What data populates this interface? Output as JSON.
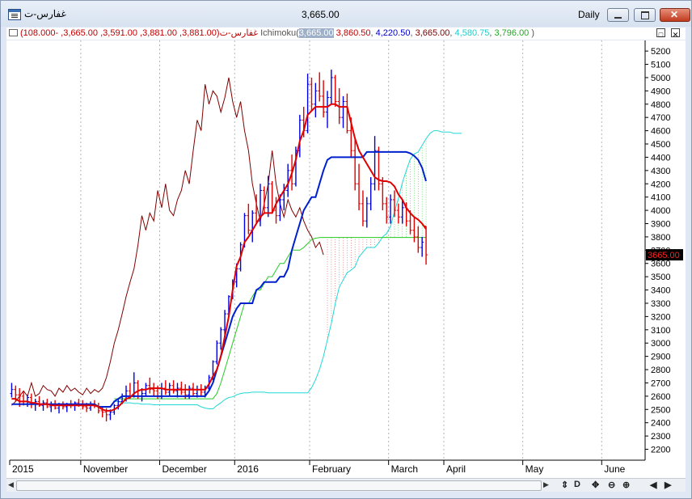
{
  "window": {
    "title": "غفارس-ت",
    "last_price": "3,665.00",
    "period": "Daily"
  },
  "legend": {
    "symbol": "غفارس-ت",
    "ohlc": "(3,881.00, 3,881.00, 3,591.00, 3,665.00, -108.000)",
    "indicator": "Ichimoku",
    "values": [
      {
        "text": "3,665.00",
        "color": "#ffffff",
        "bg": "#9db0c8"
      },
      {
        "text": "3,860.50",
        "color": "#c00000"
      },
      {
        "text": "4,220.50",
        "color": "#0000c8"
      },
      {
        "text": "3,665.00",
        "color": "#7a0000"
      },
      {
        "text": "4,580.75",
        "color": "#22cccc"
      },
      {
        "text": "3,796.00",
        "color": "#22aa22"
      }
    ],
    "open_paren": "(",
    "close_paren": ")"
  },
  "toolbar": {
    "buttons": [
      {
        "name": "sync-button",
        "label": "⇕"
      },
      {
        "name": "data-button",
        "label": "D"
      },
      {
        "name": "move-button",
        "label": "✥"
      },
      {
        "name": "zoom-out-button",
        "label": "⊖"
      },
      {
        "name": "zoom-in-button",
        "label": "⊕"
      },
      {
        "name": "scroll-left-button",
        "label": "◀"
      },
      {
        "name": "scroll-right-button",
        "label": "▶"
      }
    ]
  },
  "chart_data": {
    "type": "line",
    "title": "",
    "y_ticks": [
      2200,
      2300,
      2400,
      2500,
      2600,
      2700,
      2800,
      2900,
      3000,
      3100,
      3200,
      3300,
      3400,
      3500,
      3600,
      3700,
      3800,
      3900,
      4000,
      4100,
      4200,
      4300,
      4400,
      4500,
      4600,
      4700,
      4800,
      4900,
      5000,
      5100,
      5200
    ],
    "ylim": [
      2130,
      5280
    ],
    "last_price_label": "3665.00",
    "last_price": 3665,
    "x_labels": [
      {
        "text": "2015",
        "bar": 0
      },
      {
        "text": "November",
        "bar": 18
      },
      {
        "text": "December",
        "bar": 38
      },
      {
        "text": "2016",
        "bar": 57
      },
      {
        "text": "February",
        "bar": 76
      },
      {
        "text": "March",
        "bar": 96
      },
      {
        "text": "April",
        "bar": 110
      },
      {
        "text": "May",
        "bar": 130
      },
      {
        "text": "June",
        "bar": 150
      }
    ],
    "bar_count": 161,
    "grid_vertical_bars": [
      18,
      38,
      57,
      76,
      96,
      110,
      130,
      150
    ],
    "price_bars": [
      [
        2620,
        2700,
        2590,
        2650
      ],
      [
        2650,
        2680,
        2560,
        2610
      ],
      [
        2610,
        2660,
        2520,
        2600
      ],
      [
        2600,
        2640,
        2530,
        2560
      ],
      [
        2560,
        2610,
        2520,
        2590
      ],
      [
        2590,
        2620,
        2510,
        2540
      ],
      [
        2540,
        2580,
        2490,
        2560
      ],
      [
        2560,
        2600,
        2520,
        2530
      ],
      [
        2530,
        2570,
        2490,
        2550
      ],
      [
        2550,
        2580,
        2510,
        2520
      ],
      [
        2520,
        2560,
        2480,
        2540
      ],
      [
        2540,
        2570,
        2500,
        2510
      ],
      [
        2510,
        2550,
        2470,
        2530
      ],
      [
        2530,
        2560,
        2500,
        2520
      ],
      [
        2520,
        2550,
        2480,
        2540
      ],
      [
        2540,
        2570,
        2510,
        2530
      ],
      [
        2530,
        2560,
        2490,
        2550
      ],
      [
        2550,
        2580,
        2520,
        2540
      ],
      [
        2540,
        2570,
        2500,
        2520
      ],
      [
        2520,
        2550,
        2480,
        2510
      ],
      [
        2510,
        2560,
        2490,
        2540
      ],
      [
        2540,
        2570,
        2510,
        2530
      ],
      [
        2530,
        2550,
        2470,
        2490
      ],
      [
        2490,
        2520,
        2440,
        2480
      ],
      [
        2480,
        2510,
        2410,
        2460
      ],
      [
        2460,
        2500,
        2420,
        2480
      ],
      [
        2480,
        2540,
        2460,
        2530
      ],
      [
        2530,
        2580,
        2500,
        2560
      ],
      [
        2560,
        2620,
        2540,
        2600
      ],
      [
        2600,
        2680,
        2560,
        2640
      ],
      [
        2640,
        2700,
        2580,
        2600
      ],
      [
        2600,
        2780,
        2590,
        2700
      ],
      [
        2700,
        2720,
        2580,
        2600
      ],
      [
        2600,
        2660,
        2560,
        2620
      ],
      [
        2620,
        2700,
        2600,
        2680
      ],
      [
        2680,
        2740,
        2620,
        2650
      ],
      [
        2650,
        2700,
        2600,
        2640
      ],
      [
        2640,
        2680,
        2580,
        2600
      ],
      [
        2600,
        2700,
        2580,
        2660
      ],
      [
        2660,
        2720,
        2610,
        2630
      ],
      [
        2630,
        2700,
        2600,
        2680
      ],
      [
        2680,
        2720,
        2620,
        2640
      ],
      [
        2640,
        2700,
        2590,
        2660
      ],
      [
        2660,
        2710,
        2610,
        2630
      ],
      [
        2630,
        2690,
        2580,
        2610
      ],
      [
        2610,
        2680,
        2580,
        2660
      ],
      [
        2660,
        2700,
        2600,
        2620
      ],
      [
        2620,
        2680,
        2590,
        2650
      ],
      [
        2650,
        2690,
        2600,
        2630
      ],
      [
        2630,
        2680,
        2590,
        2660
      ],
      [
        2660,
        2760,
        2640,
        2740
      ],
      [
        2740,
        2870,
        2720,
        2860
      ],
      [
        2860,
        3020,
        2840,
        3000
      ],
      [
        3000,
        3120,
        2950,
        3100
      ],
      [
        3100,
        3250,
        3050,
        3220
      ],
      [
        3220,
        3360,
        3200,
        3350
      ],
      [
        3350,
        3480,
        3330,
        3460
      ],
      [
        3460,
        3600,
        3420,
        3560
      ],
      [
        3560,
        3760,
        3540,
        3740
      ],
      [
        3740,
        3980,
        3720,
        3960
      ],
      [
        3960,
        4050,
        3820,
        3850
      ],
      [
        3850,
        4000,
        3760,
        3980
      ],
      [
        3980,
        4120,
        3900,
        3920
      ],
      [
        3920,
        4200,
        3880,
        4150
      ],
      [
        4150,
        4180,
        3980,
        4020
      ],
      [
        4020,
        4260,
        3950,
        4200
      ],
      [
        4200,
        4220,
        3980,
        4000
      ],
      [
        4000,
        4100,
        3900,
        3960
      ],
      [
        3960,
        4120,
        3920,
        4080
      ],
      [
        4080,
        4200,
        4000,
        4150
      ],
      [
        4150,
        4350,
        4100,
        4300
      ],
      [
        4300,
        4420,
        4150,
        4200
      ],
      [
        4200,
        4480,
        4180,
        4450
      ],
      [
        4450,
        4720,
        4400,
        4680
      ],
      [
        4680,
        4780,
        4550,
        4600
      ],
      [
        4600,
        5030,
        4580,
        4950
      ],
      [
        4950,
        5000,
        4750,
        4800
      ],
      [
        4800,
        4960,
        4700,
        4900
      ],
      [
        4900,
        5040,
        4820,
        4860
      ],
      [
        4860,
        4980,
        4700,
        4740
      ],
      [
        4740,
        4900,
        4620,
        4850
      ],
      [
        4850,
        5060,
        4800,
        5000
      ],
      [
        5000,
        5020,
        4780,
        4820
      ],
      [
        4820,
        4920,
        4650,
        4700
      ],
      [
        4700,
        4860,
        4620,
        4820
      ],
      [
        4820,
        4880,
        4580,
        4600
      ],
      [
        4600,
        4700,
        4400,
        4450
      ],
      [
        4450,
        4550,
        4150,
        4200
      ],
      [
        4200,
        4350,
        4000,
        4050
      ],
      [
        4050,
        4150,
        3880,
        3920
      ],
      [
        3920,
        4100,
        3870,
        4050
      ],
      [
        4050,
        4250,
        4000,
        4200
      ],
      [
        4200,
        4560,
        4150,
        4450
      ],
      [
        4450,
        4480,
        4150,
        4200
      ],
      [
        4200,
        4250,
        4000,
        4050
      ],
      [
        4050,
        4100,
        3900,
        3950
      ],
      [
        3950,
        4120,
        3900,
        4080
      ],
      [
        4080,
        4150,
        3950,
        4000
      ],
      [
        4000,
        4050,
        3900,
        3950
      ],
      [
        3950,
        4080,
        3900,
        4020
      ],
      [
        4020,
        4060,
        3880,
        3920
      ],
      [
        3920,
        4000,
        3820,
        3850
      ],
      [
        3850,
        3950,
        3760,
        3800
      ],
      [
        3800,
        3880,
        3680,
        3720
      ],
      [
        3720,
        3800,
        3650,
        3760
      ],
      [
        3881,
        3881,
        3591,
        3665
      ]
    ],
    "series": [
      {
        "name": "",
        "role": "tenkan",
        "color": "#e00000",
        "offset": 0,
        "values": [
          2580,
          2580,
          2560,
          2560,
          2560,
          2550,
          2550,
          2540,
          2540,
          2540,
          2530,
          2530,
          2530,
          2530,
          2530,
          2530,
          2530,
          2530,
          2530,
          2530,
          2530,
          2530,
          2520,
          2500,
          2490,
          2490,
          2500,
          2520,
          2550,
          2580,
          2590,
          2620,
          2640,
          2650,
          2650,
          2660,
          2660,
          2660,
          2660,
          2650,
          2650,
          2650,
          2650,
          2650,
          2650,
          2650,
          2650,
          2650,
          2650,
          2650,
          2690,
          2750,
          2800,
          2900,
          3050,
          3200,
          3400,
          3580,
          3650,
          3760,
          3800,
          3850,
          3900,
          3950,
          3980,
          3980,
          3980,
          4050,
          4100,
          4150,
          4200,
          4280,
          4380,
          4520,
          4600,
          4720,
          4750,
          4780,
          4780,
          4780,
          4780,
          4800,
          4800,
          4780,
          4780,
          4780,
          4660,
          4540,
          4450,
          4400,
          4350,
          4300,
          4250,
          4230,
          4220,
          4220,
          4210,
          4180,
          4120,
          4080,
          4020,
          3980,
          3950,
          3930,
          3900,
          3860
        ]
      },
      {
        "name": "",
        "role": "kijun",
        "color": "#0020d0",
        "offset": 0,
        "values": [
          2540,
          2540,
          2540,
          2540,
          2540,
          2540,
          2540,
          2540,
          2540,
          2540,
          2540,
          2540,
          2540,
          2540,
          2540,
          2540,
          2540,
          2540,
          2540,
          2540,
          2540,
          2540,
          2520,
          2520,
          2520,
          2520,
          2560,
          2580,
          2600,
          2600,
          2600,
          2600,
          2600,
          2600,
          2600,
          2600,
          2600,
          2600,
          2600,
          2600,
          2600,
          2600,
          2600,
          2600,
          2600,
          2600,
          2600,
          2600,
          2600,
          2600,
          2640,
          2700,
          2800,
          2900,
          3000,
          3100,
          3200,
          3260,
          3300,
          3300,
          3300,
          3300,
          3400,
          3420,
          3460,
          3460,
          3460,
          3460,
          3500,
          3500,
          3560,
          3700,
          3800,
          3900,
          4000,
          4050,
          4100,
          4100,
          4200,
          4300,
          4380,
          4400,
          4400,
          4400,
          4400,
          4400,
          4400,
          4400,
          4400,
          4400,
          4440,
          4440,
          4440,
          4440,
          4440,
          4440,
          4440,
          4440,
          4440,
          4440,
          4440,
          4430,
          4410,
          4380,
          4320,
          4220
        ]
      },
      {
        "name": "",
        "role": "chikou",
        "color": "#800000",
        "offset": -26,
        "values": [
          2620,
          2610,
          2600,
          2560,
          2590,
          2540,
          2560,
          2530,
          2550,
          2520,
          2540,
          2510,
          2530,
          2520,
          2540,
          2530,
          2550,
          2540,
          2520,
          2510,
          2540,
          2530,
          2490,
          2480,
          2460,
          2480,
          2530,
          2560,
          2600,
          2640,
          2600,
          2700,
          2600,
          2620,
          2680,
          2650,
          2640,
          2600,
          2660,
          2630,
          2680,
          2640,
          2660,
          2630,
          2610,
          2660,
          2620,
          2650,
          2630,
          2660,
          2740,
          2860,
          3000,
          3100,
          3220,
          3350,
          3460,
          3560,
          3740,
          3960,
          3850,
          3980,
          3920,
          4150,
          4020,
          4200,
          4000,
          3960,
          4080,
          4150,
          4300,
          4200,
          4450,
          4680,
          4600,
          4950,
          4800,
          4900,
          4860,
          4740,
          4850,
          5000,
          4820,
          4700,
          4820,
          4600,
          4450,
          4200,
          4050,
          3920,
          4050,
          4200,
          4450,
          4200,
          4050,
          3950,
          4080,
          4000,
          3950,
          4020,
          3920,
          3850,
          3800,
          3720,
          3760,
          3665
        ]
      },
      {
        "name": "",
        "role": "senkou-a",
        "color": "#22d8d8",
        "offset": 26,
        "values": [
          2560,
          2560,
          2550,
          2550,
          2550,
          2545,
          2545,
          2540,
          2540,
          2540,
          2535,
          2535,
          2535,
          2535,
          2535,
          2535,
          2535,
          2535,
          2535,
          2535,
          2535,
          2535,
          2520,
          2510,
          2505,
          2505,
          2530,
          2550,
          2575,
          2590,
          2595,
          2610,
          2620,
          2625,
          2625,
          2630,
          2630,
          2630,
          2630,
          2625,
          2625,
          2625,
          2625,
          2625,
          2625,
          2625,
          2625,
          2625,
          2625,
          2625,
          2665,
          2725,
          2800,
          2900,
          3025,
          3150,
          3300,
          3420,
          3475,
          3530,
          3550,
          3575,
          3650,
          3685,
          3720,
          3720,
          3720,
          3755,
          3800,
          3825,
          3880,
          3990,
          4090,
          4210,
          4300,
          4385,
          4425,
          4440,
          4490,
          4540,
          4580,
          4600,
          4600,
          4590,
          4590,
          4590,
          4580,
          4580,
          4580
        ]
      },
      {
        "name": "",
        "role": "senkou-b",
        "color": "#22cc22",
        "offset": 26,
        "values": [
          2580,
          2580,
          2580,
          2580,
          2580,
          2580,
          2580,
          2580,
          2580,
          2580,
          2580,
          2580,
          2580,
          2580,
          2580,
          2580,
          2580,
          2580,
          2580,
          2580,
          2580,
          2580,
          2580,
          2580,
          2580,
          2580,
          2620,
          2700,
          2800,
          2900,
          3000,
          3100,
          3200,
          3300,
          3300,
          3350,
          3400,
          3400,
          3450,
          3500,
          3500,
          3550,
          3600,
          3600,
          3650,
          3700,
          3700,
          3700,
          3720,
          3750,
          3780,
          3790,
          3795,
          3796,
          3796,
          3796,
          3796,
          3796,
          3796,
          3796,
          3796,
          3796,
          3796,
          3796,
          3796,
          3796,
          3796,
          3796,
          3796,
          3796,
          3796,
          3796,
          3796,
          3796,
          3796,
          3796,
          3796,
          3796,
          3796,
          3796
        ]
      }
    ],
    "senkou_b_start": 80,
    "grid": "vertical-dotted"
  }
}
